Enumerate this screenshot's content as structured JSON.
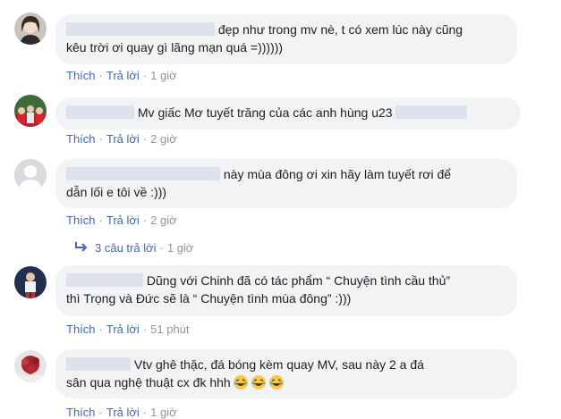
{
  "comments": [
    {
      "text_line1": "đẹp như trong mv nè, t có xem lúc này cũng",
      "text_line2": "kêu trời ơi quay gì lãng mạn quá =))))))",
      "like": "Thích",
      "reply": "Trả lời",
      "time": "1 giờ"
    },
    {
      "text_line1": "Mv giấc Mơ tuyết trăng của các anh hùng u23",
      "like": "Thích",
      "reply": "Trả lời",
      "time": "2 giờ"
    },
    {
      "text_line1": "này mùa đông ơi xin hãy làm tuyết rơi để",
      "text_line2": "dẫn lối e tôi về :)))",
      "like": "Thích",
      "reply": "Trả lời",
      "time": "2 giờ",
      "replies_label": "3 câu trả lời",
      "replies_time": "1 giờ"
    },
    {
      "text_line1": "Dũng với Chinh đã có tác phẩm “ Chuyện tình cầu thủ”",
      "text_line2": "thì Trọng và Đức sẽ là “ Chuyện tình mùa đông” :)))",
      "like": "Thích",
      "reply": "Trả lời",
      "time": "51 phút"
    },
    {
      "text_line1": "Vtv ghê thặc, đá bóng kèm quay MV, sau này 2 a đá",
      "text_line2": "sân qua nghệ thuật cx đk hhh",
      "like": "Thích",
      "reply": "Trả lời",
      "time": "1 giờ"
    }
  ],
  "icons": {
    "reply_arrow": "reply-arrow-icon",
    "emoji": "laughing-tears-emoji-icon"
  },
  "colors": {
    "link": "#4267b2",
    "meta": "#90949c",
    "bubble": "#f2f3f5",
    "redaction": "#dde2ec"
  }
}
